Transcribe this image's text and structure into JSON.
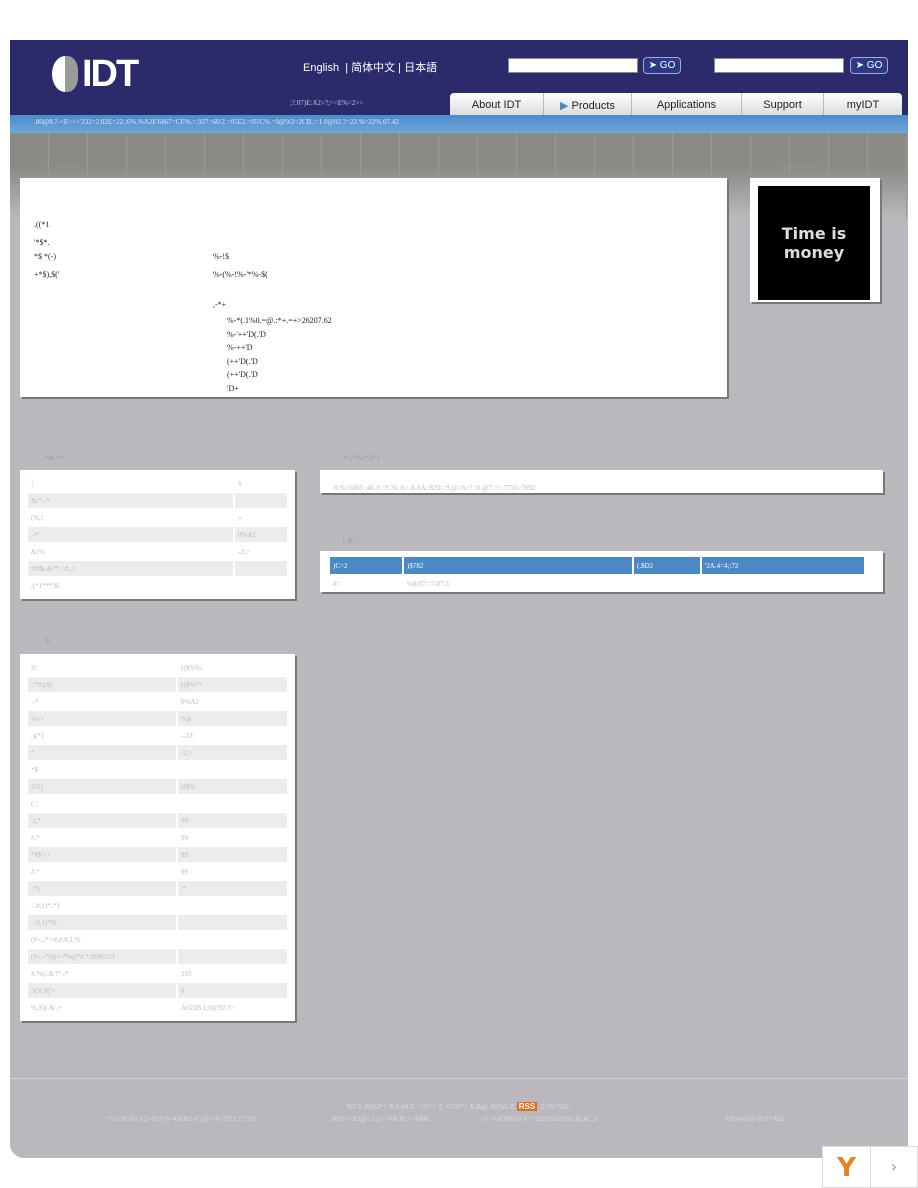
{
  "header": {
    "logo": "IDT",
    "languages": [
      "English",
      "简体中文",
      "日本語"
    ],
    "tagline": ";?.07)E:A2>?;=<E%=2>>",
    "go_label": "GO"
  },
  "nav": [
    "About IDT",
    "Products",
    "Applications",
    "Support",
    "myIDT"
  ],
  "breadcrumb": ".80@8.?-<E<<>'232=2.02E=22.:6%.%A2E'6867=CE%.=.927=60/2.=05E2.=05'C%.=9@9/2=2CB.;=1.0@92.?=22.%=22%.07.42",
  "band": {
    "left": "9/2     %=1.0??",
    "right": ";@9.C8>8672"
  },
  "main": {
    "title": ".((*1",
    "labels": [
      "'*$*.",
      "*$ *(-)",
      "+*$),$('"
    ],
    "values": [
      "%-!$",
      "%-(%-!%-'*%-$("
    ],
    "list_head": ",-*+",
    "list": [
      "%-*(.1%0.=@.:*+.=+>26207.62",
      "%-'++'D(.'D",
      "%-++'D",
      "(++'D(.'D",
      "(++'D(.'D",
      "'D+"
    ]
  },
  "promo": {
    "title": "Time is money"
  },
  "table1": {
    "heading": "*&.*+",
    "rows": [
      [
        "!",
        "#"
      ],
      [
        "&!*.-*",
        ""
      ],
      [
        "(%,!",
        "+"
      ],
      [
        ".-*",
        "0%A2"
      ],
      [
        "&!%",
        "-2;>"
      ],
      [
        "#'#&-&**-',#,,1",
        ""
      ],
      [
        ",(*1***'&',",
        ""
      ]
    ]
  },
  "table2": {
    "heading": "S!",
    "rows": [
      [
        "S!",
        "(($%%-"
      ],
      [
        "=*#),#('",
        "(($%**"
      ],
      [
        ".-*",
        "0%A2"
      ],
      [
        "%++",
        "%)("
      ],
      [
        ",)(*1",
        "--22:"
      ],
      [
        "*",
        "-2;>"
      ],
      [
        "*$",
        ""
      ],
      [
        "S!1)",
        "(($%"
      ],
      [
        "(-',",
        ""
      ],
      [
        "'1,*",
        "99"
      ],
      [
        "#,*",
        "99"
      ],
      [
        "*#$'++",
        "99"
      ],
      [
        "#,*",
        "99"
      ],
      [
        "-*1",
        "/*"
      ],
      [
        "-',#,1)*-*1",
        ""
      ],
      [
        "-',#,1)*%",
        ""
      ],
      [
        "(#+,-*'+#,#,#,1,%",
        ""
      ],
      [
        "(#+,-*0)(+-*%((*#  *.8696721",
        ","
      ],
      [
        "S.%(/.&'!*.-*",
        "393"
      ],
      [
        "S('#,#('+",
        "#"
      ],
      [
        "%,S)(-&',+",
        "A623B.1;0@92.?>"
      ]
    ]
  },
  "section3": {
    "heading": "#=;*#-(*',(*1",
    "text": "#:%=6065 ;46.3;=9.76;;6>.A.6A./823=;9;@=6>7=6.@7;=<.7756>7692"
  },
  "section4": {
    "heading": "(-&',+",
    "columns": [
      ")C=2",
      ")$782",
      "(.$D2",
      "'2A.4=4;:72"
    ],
    "row": [
      "#=",
      "%8;07=;7.07.3;"
    ]
  },
  "footer": {
    "links": [
      "9/2",
      "E",
      "d6%2*<",
      "E",
      "0.4A",
      "E",
      ".=22=>",
      "E",
      "<7.07*>",
      "E",
      "&@.A6%C.E"
    ],
    "rss": "RSS",
    "after_rss": ".5.76>?56>",
    "bottom": [
      "*<2:3?56>3:2<6?2>6<4.6362>C;@=.4=22?2.??;?52",
      ".602<7/A2@>2.;1<=6A.0C<:A60C",
      "<;C=6459F/32:4=.?212A602156,;&;4C:3",
      "SX%4510>2>2=A21"
    ]
  },
  "colors": {
    "header": "#2b2a6b",
    "bluebar": "#4b8ccc",
    "table_head": "#4a89c6",
    "rss": "#e36b1c"
  }
}
